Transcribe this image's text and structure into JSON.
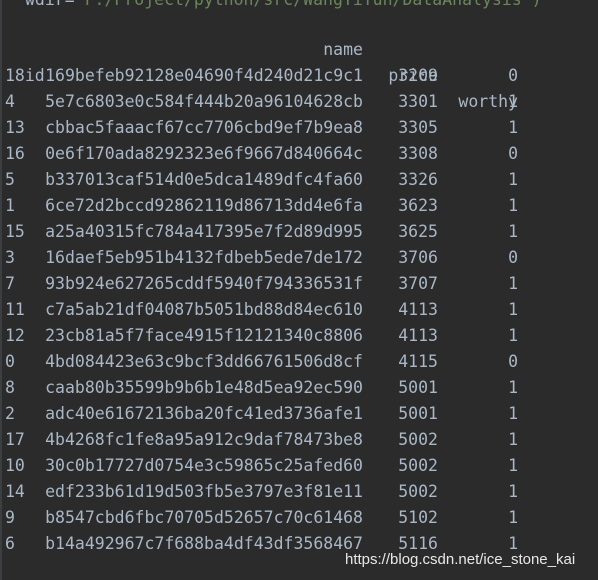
{
  "command_tail": {
    "prefix": "wdir=",
    "path": "'F:/Project/python/src/WangYiYun/DataAnalysis')"
  },
  "columns": {
    "index": "id",
    "name": "name",
    "price": "price",
    "worthy": "worthy"
  },
  "rows": [
    {
      "id": "18",
      "name": "169befeb92128e04690f4d240d21c9c1",
      "price": "3209",
      "worthy": "0"
    },
    {
      "id": "4",
      "name": "5e7c6803e0c584f444b20a96104628cb",
      "price": "3301",
      "worthy": "1"
    },
    {
      "id": "13",
      "name": "cbbac5faaacf67cc7706cbd9ef7b9ea8",
      "price": "3305",
      "worthy": "1"
    },
    {
      "id": "16",
      "name": "0e6f170ada8292323e6f9667d840664c",
      "price": "3308",
      "worthy": "0"
    },
    {
      "id": "5",
      "name": "b337013caf514d0e5dca1489dfc4fa60",
      "price": "3326",
      "worthy": "1"
    },
    {
      "id": "1",
      "name": "6ce72d2bccd92862119d86713dd4e6fa",
      "price": "3623",
      "worthy": "1"
    },
    {
      "id": "15",
      "name": "a25a40315fc784a417395e7f2d89d995",
      "price": "3625",
      "worthy": "1"
    },
    {
      "id": "3",
      "name": "16daef5eb951b4132fdbeb5ede7de172",
      "price": "3706",
      "worthy": "0"
    },
    {
      "id": "7",
      "name": "93b924e627265cddf5940f794336531f",
      "price": "3707",
      "worthy": "1"
    },
    {
      "id": "11",
      "name": "c7a5ab21df04087b5051bd88d84ec610",
      "price": "4113",
      "worthy": "1"
    },
    {
      "id": "12",
      "name": "23cb81a5f7face4915f12121340c8806",
      "price": "4113",
      "worthy": "1"
    },
    {
      "id": "0",
      "name": "4bd084423e63c9bcf3dd66761506d8cf",
      "price": "4115",
      "worthy": "0"
    },
    {
      "id": "8",
      "name": "caab80b35599b9b6b1e48d5ea92ec590",
      "price": "5001",
      "worthy": "1"
    },
    {
      "id": "2",
      "name": "adc40e61672136ba20fc41ed3736afe1",
      "price": "5001",
      "worthy": "1"
    },
    {
      "id": "17",
      "name": "4b4268fc1fe8a95a912c9daf78473be8",
      "price": "5002",
      "worthy": "1"
    },
    {
      "id": "10",
      "name": "30c0b17727d0754e3c59865c25afed60",
      "price": "5002",
      "worthy": "1"
    },
    {
      "id": "14",
      "name": "edf233b61d19d503fb5e3797e3f81e11",
      "price": "5002",
      "worthy": "1"
    },
    {
      "id": "9",
      "name": "b8547cbd6fbc70705d52657c70c61468",
      "price": "5102",
      "worthy": "1"
    },
    {
      "id": "6",
      "name": "b14a492967c7f688ba4df43df3568467",
      "price": "5116",
      "worthy": "1"
    }
  ],
  "watermark": "https://blog.csdn.net/ice_stone_kai",
  "colors": {
    "background": "#2b2b2b",
    "text": "#a9b7c6",
    "string": "#6a8759"
  }
}
